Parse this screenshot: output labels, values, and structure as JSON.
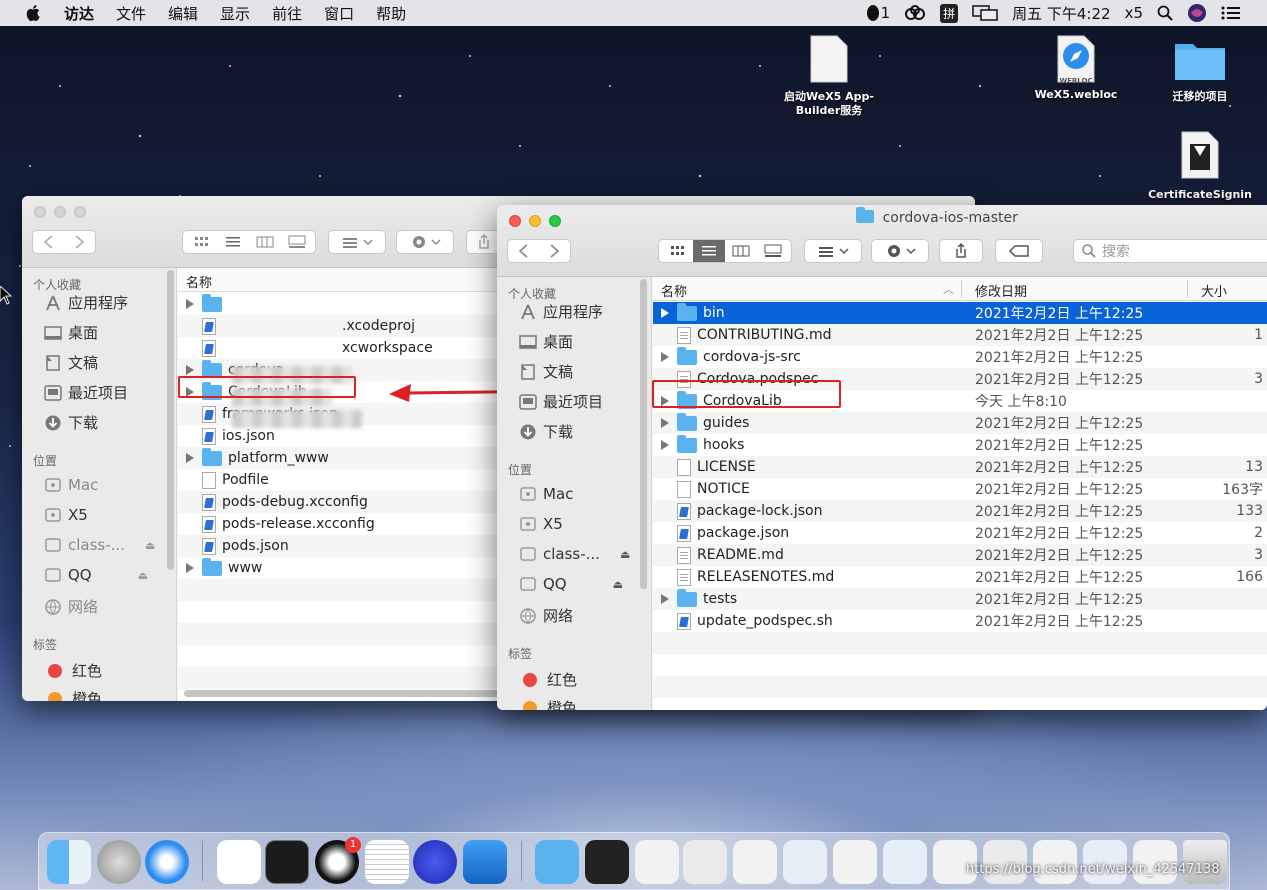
{
  "menubar": {
    "items": [
      "访达",
      "文件",
      "编辑",
      "显示",
      "前往",
      "窗口",
      "帮助"
    ],
    "qq_count": "1",
    "ime": "拼",
    "clock": "周五 下午4:22",
    "app": "x5"
  },
  "desktop": {
    "icons": [
      {
        "label": "启动WeX5 App-Builder服务"
      },
      {
        "label": "WeX5.webloc",
        "badge": "WEBLOC"
      },
      {
        "label": "迁移的项目"
      },
      {
        "label": "CertificateSignin"
      }
    ]
  },
  "left_window": {
    "sidebar": {
      "favorites_heading": "个人收藏",
      "favorites": [
        "应用程序",
        "桌面",
        "文稿",
        "最近项目",
        "下载"
      ],
      "locations_heading": "位置",
      "locations": [
        "Mac",
        "X5",
        "class-...",
        "QQ",
        "网络"
      ],
      "tags_heading": "标签",
      "tags": [
        {
          "label": "红色",
          "color": "#e9473f"
        },
        {
          "label": "橙色",
          "color": "#f39a2a"
        }
      ]
    },
    "column_header": "名称",
    "files": [
      {
        "name": "",
        "kind": "folder",
        "expandable": true,
        "redacted": true
      },
      {
        "name": ".xcodeproj",
        "kind": "doc-blue",
        "redacted": true
      },
      {
        "name": "xcworkspace",
        "kind": "doc-blue",
        "redacted": true
      },
      {
        "name": "cordova",
        "kind": "folder",
        "expandable": true
      },
      {
        "name": "CordovaLib",
        "kind": "folder",
        "expandable": true,
        "highlighted": true
      },
      {
        "name": "frameworks.json",
        "kind": "doc-blue"
      },
      {
        "name": "ios.json",
        "kind": "doc-blue"
      },
      {
        "name": "platform_www",
        "kind": "folder",
        "expandable": true
      },
      {
        "name": "Podfile",
        "kind": "doc"
      },
      {
        "name": "pods-debug.xcconfig",
        "kind": "doc-blue"
      },
      {
        "name": "pods-release.xcconfig",
        "kind": "doc-blue"
      },
      {
        "name": "pods.json",
        "kind": "doc-blue"
      },
      {
        "name": "www",
        "kind": "folder",
        "expandable": true
      }
    ]
  },
  "right_window": {
    "title": "cordova-ios-master",
    "search_placeholder": "搜索",
    "sidebar": {
      "favorites_heading": "个人收藏",
      "favorites": [
        "应用程序",
        "桌面",
        "文稿",
        "最近项目",
        "下载"
      ],
      "locations_heading": "位置",
      "locations": [
        "Mac",
        "X5",
        "class-...",
        "QQ",
        "网络"
      ],
      "tags_heading": "标签",
      "tags": [
        {
          "label": "红色",
          "color": "#e9473f"
        },
        {
          "label": "橙色",
          "color": "#f39a2a"
        }
      ]
    },
    "columns": {
      "name": "名称",
      "modified": "修改日期",
      "size": "大小"
    },
    "files": [
      {
        "name": "bin",
        "kind": "folder",
        "expandable": true,
        "date": "2021年2月2日 上午12:25",
        "size": "",
        "selected": true
      },
      {
        "name": "CONTRIBUTING.md",
        "kind": "doc-txt",
        "date": "2021年2月2日 上午12:25",
        "size": "1"
      },
      {
        "name": "cordova-js-src",
        "kind": "folder",
        "expandable": true,
        "date": "2021年2月2日 上午12:25",
        "size": ""
      },
      {
        "name": "Cordova.podspec",
        "kind": "doc-txt",
        "date": "2021年2月2日 上午12:25",
        "size": "3"
      },
      {
        "name": "CordovaLib",
        "kind": "folder",
        "expandable": true,
        "date": "今天 上午8:10",
        "size": "",
        "highlighted": true
      },
      {
        "name": "guides",
        "kind": "folder",
        "expandable": true,
        "date": "2021年2月2日 上午12:25",
        "size": ""
      },
      {
        "name": "hooks",
        "kind": "folder",
        "expandable": true,
        "date": "2021年2月2日 上午12:25",
        "size": ""
      },
      {
        "name": "LICENSE",
        "kind": "doc",
        "date": "2021年2月2日 上午12:25",
        "size": "13"
      },
      {
        "name": "NOTICE",
        "kind": "doc",
        "date": "2021年2月2日 上午12:25",
        "size": "163字"
      },
      {
        "name": "package-lock.json",
        "kind": "doc-blue",
        "date": "2021年2月2日 上午12:25",
        "size": "133"
      },
      {
        "name": "package.json",
        "kind": "doc-blue",
        "date": "2021年2月2日 上午12:25",
        "size": "2"
      },
      {
        "name": "README.md",
        "kind": "doc-txt",
        "date": "2021年2月2日 上午12:25",
        "size": "3"
      },
      {
        "name": "RELEASENOTES.md",
        "kind": "doc-txt",
        "date": "2021年2月2日 上午12:25",
        "size": "166"
      },
      {
        "name": "tests",
        "kind": "folder",
        "expandable": true,
        "date": "2021年2月2日 上午12:25",
        "size": ""
      },
      {
        "name": "update_podspec.sh",
        "kind": "doc-blue",
        "date": "2021年2月2日 上午12:25",
        "size": ""
      }
    ]
  },
  "watermark": "https://blog.csdn.net/weixin_42547138",
  "dock": {
    "qq_badge": "1"
  }
}
